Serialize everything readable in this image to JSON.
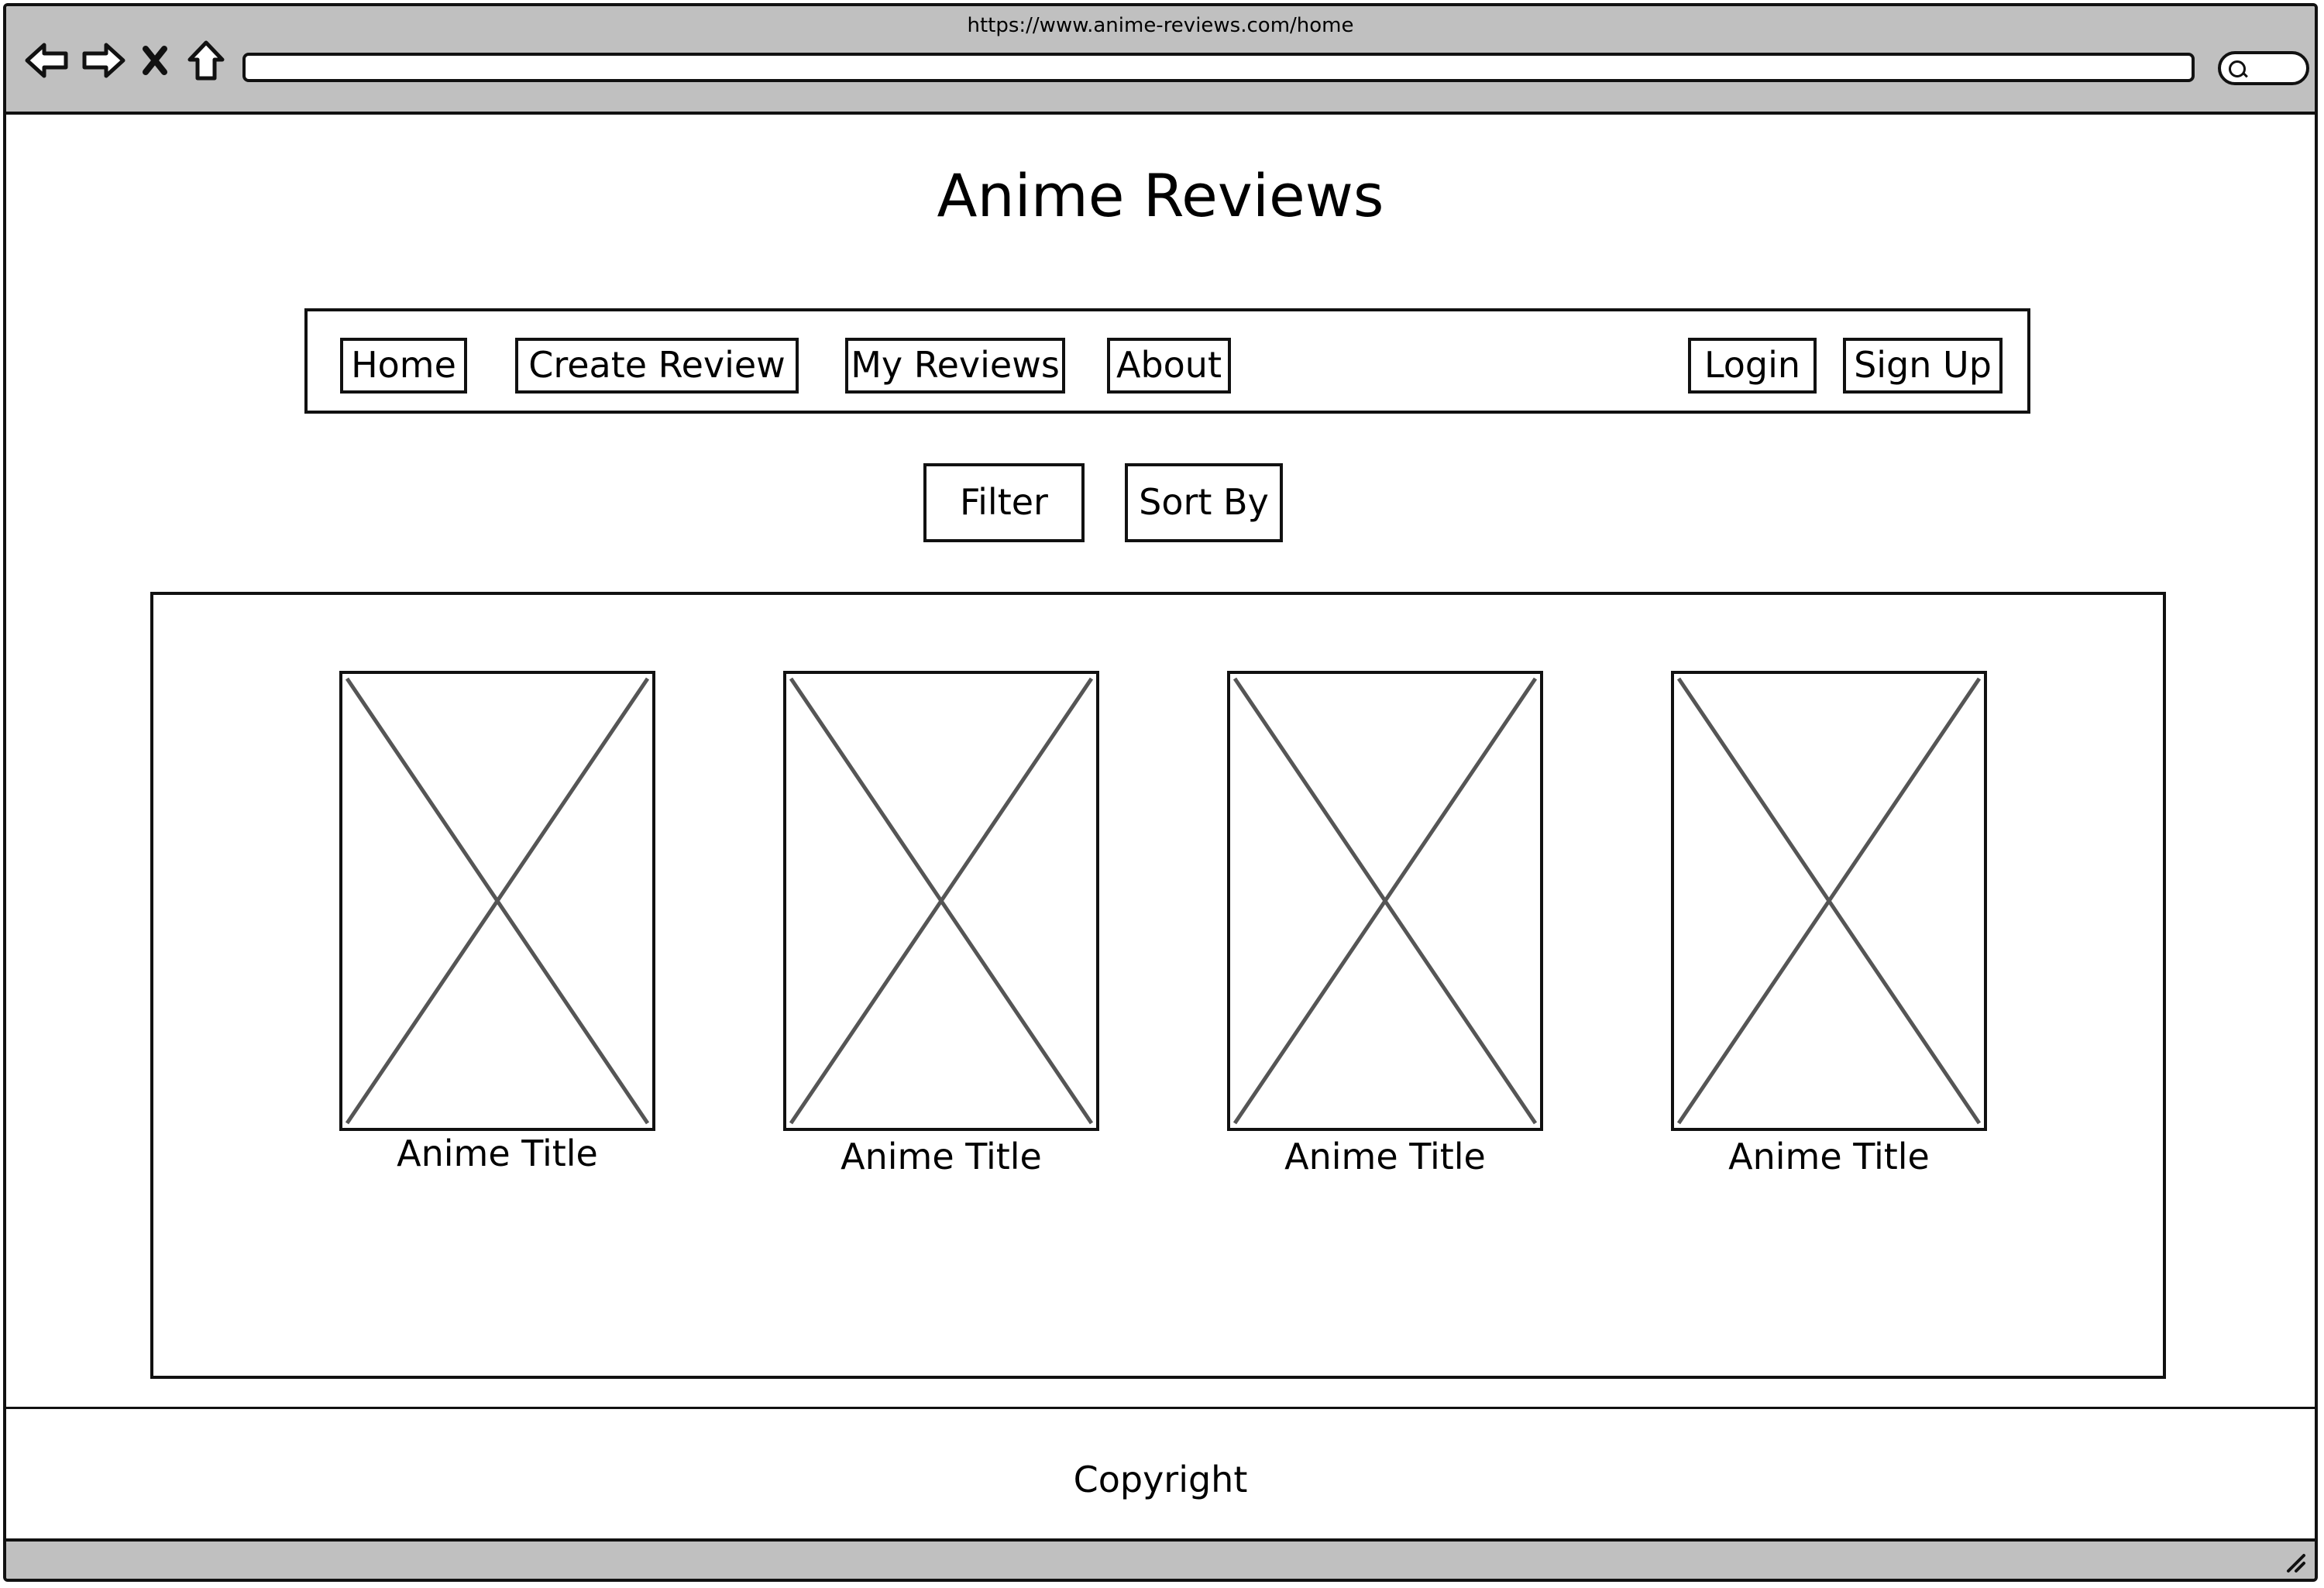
{
  "browser": {
    "url": "https://www.anime-reviews.com/home",
    "icons": [
      "back-arrow-icon",
      "forward-arrow-icon",
      "close-icon",
      "home-icon",
      "search-icon"
    ]
  },
  "page": {
    "title": "Anime Reviews"
  },
  "nav": {
    "home": "Home",
    "create_review": "Create Review",
    "my_reviews": "My Reviews",
    "about": "About",
    "login": "Login",
    "sign_up": "Sign Up"
  },
  "toolbar": {
    "filter": "Filter",
    "sort_by": "Sort By"
  },
  "cards": [
    {
      "title": "Anime Title"
    },
    {
      "title": "Anime Title"
    },
    {
      "title": "Anime Title"
    },
    {
      "title": "Anime Title"
    }
  ],
  "footer": {
    "text": "Copyright"
  },
  "colors": {
    "chrome": "#c0c0c0",
    "stroke": "#111111",
    "placeholder_x": "#555555"
  }
}
